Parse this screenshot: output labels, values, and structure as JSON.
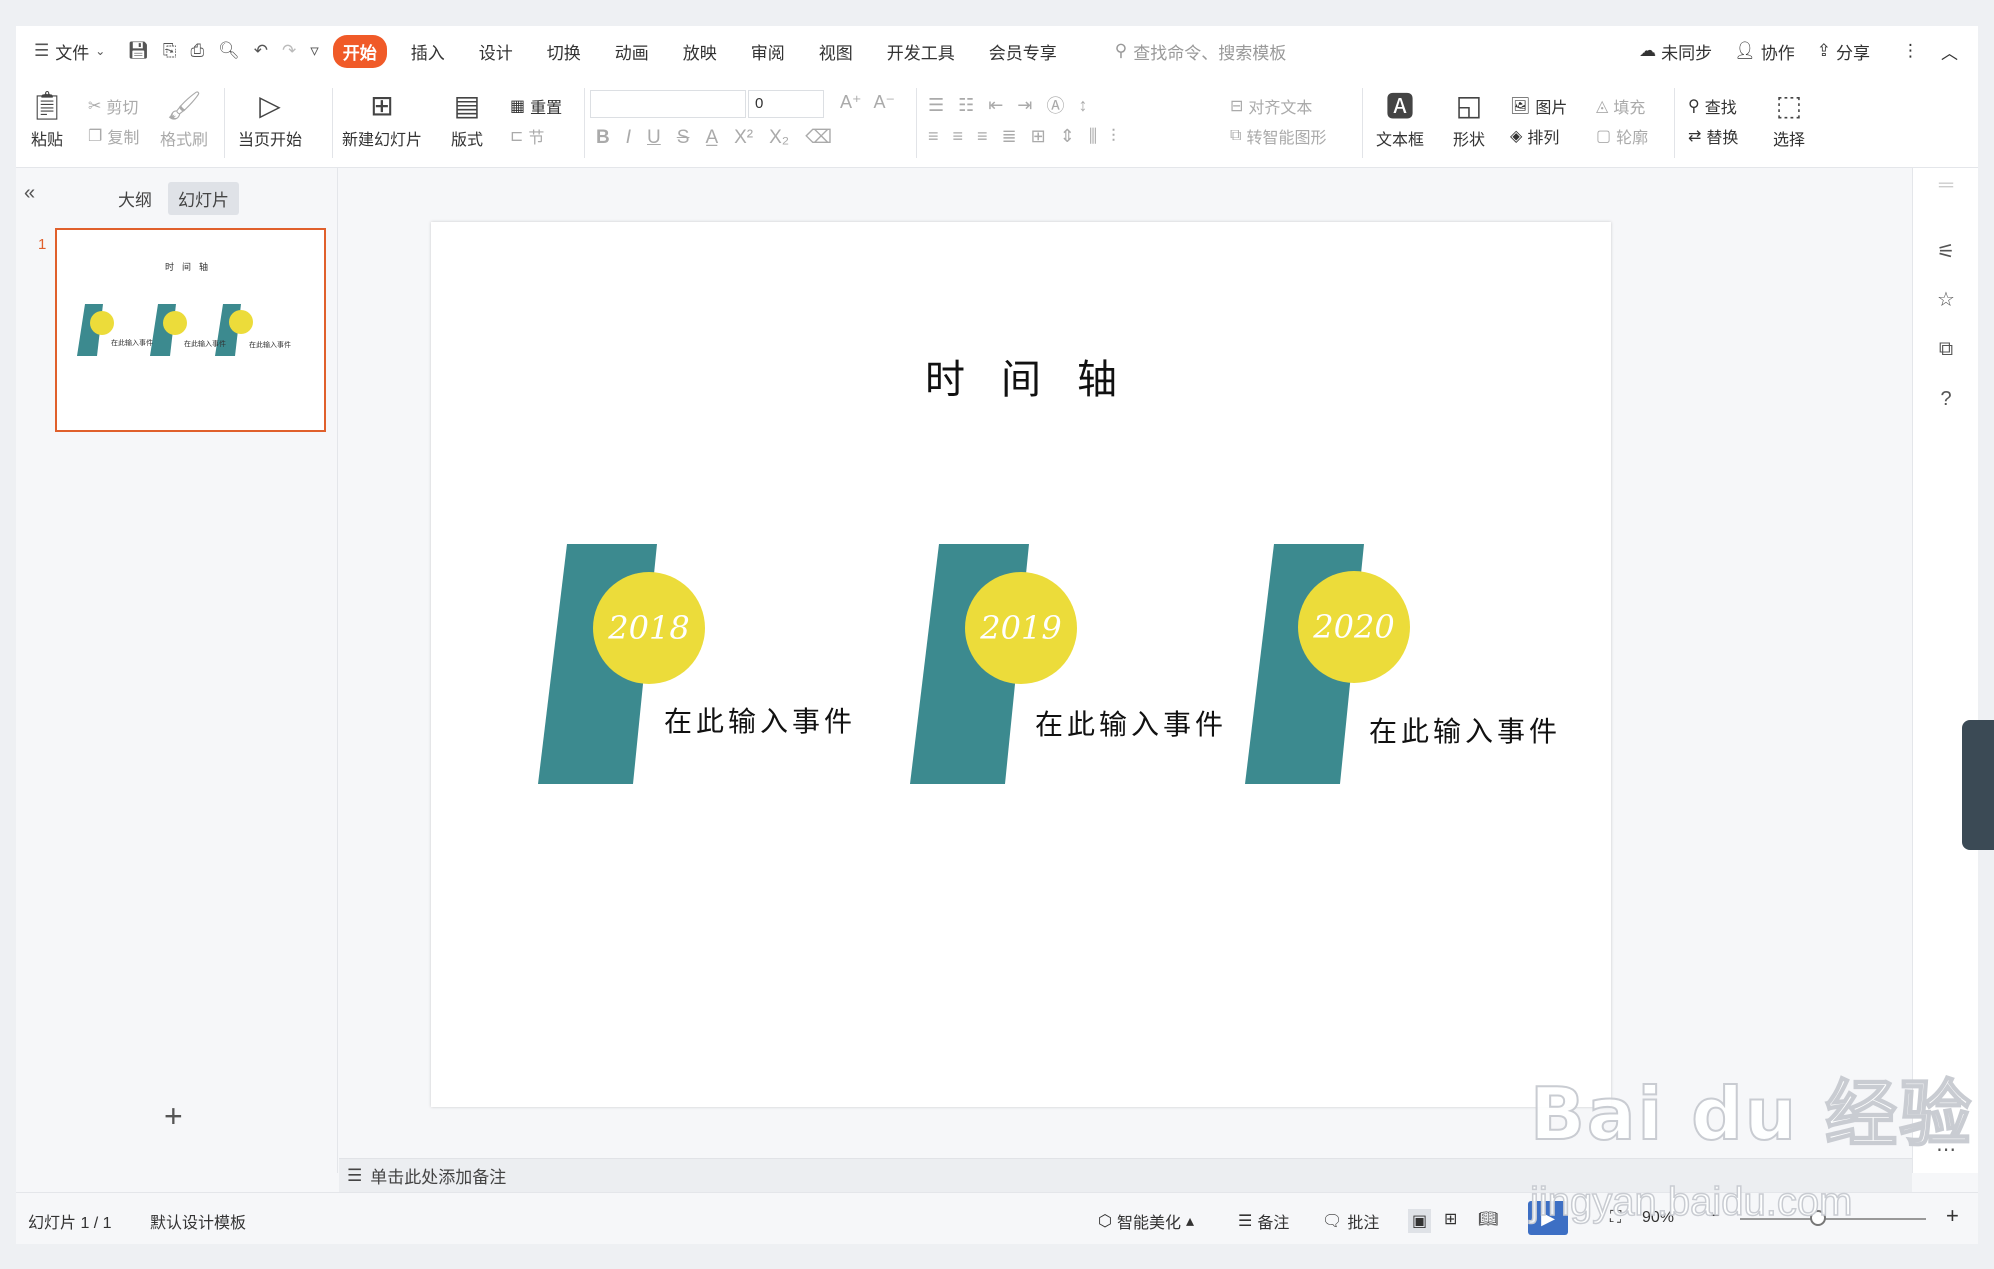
{
  "menubar": {
    "file": "文件",
    "tabs": [
      "开始",
      "插入",
      "设计",
      "切换",
      "动画",
      "放映",
      "审阅",
      "视图",
      "开发工具",
      "会员专享"
    ],
    "active_tab": "开始",
    "search_placeholder": "查找命令、搜索模板",
    "unsynced": "未同步",
    "collaborate": "协作",
    "share": "分享"
  },
  "ribbon": {
    "paste": "粘贴",
    "cut": "剪切",
    "copy": "复制",
    "format_painter": "格式刷",
    "play_current": "当页开始",
    "new_slide": "新建幻灯片",
    "layout": "版式",
    "reset": "重置",
    "section": "节",
    "font_size": "0",
    "align_text": "对齐文本",
    "smart_art": "转智能图形",
    "textbox": "文本框",
    "shape": "形状",
    "picture": "图片",
    "fill": "填充",
    "arrange": "排列",
    "outline": "轮廓",
    "find": "查找",
    "replace": "替换",
    "select": "选择"
  },
  "leftpanel": {
    "outline_tab": "大纲",
    "slides_tab": "幻灯片",
    "slide_number": "1"
  },
  "slide": {
    "title": "时间轴",
    "items": [
      {
        "year": "2018",
        "event": "在此输入事件"
      },
      {
        "year": "2019",
        "event": "在此输入事件"
      },
      {
        "year": "2020",
        "event": "在此输入事件"
      }
    ],
    "colors": {
      "teal": "#3c8a8f",
      "yellow": "#ecdc3a",
      "accent": "#f05a28"
    }
  },
  "notes": {
    "placeholder": "单击此处添加备注"
  },
  "status": {
    "slide_count": "幻灯片 1 / 1",
    "template": "默认设计模板",
    "beautify": "智能美化",
    "notes": "备注",
    "comments": "批注",
    "zoom": "90%"
  },
  "watermark": {
    "text": "Bai du 经验",
    "url": "jingyan.baidu.com"
  }
}
